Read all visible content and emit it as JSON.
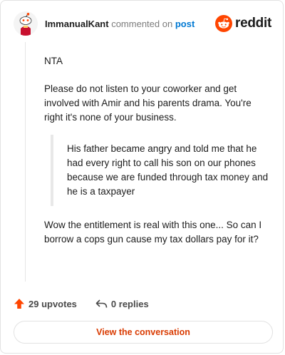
{
  "header": {
    "username": "ImmanualKant",
    "action_text": "commented on",
    "post_link": "post",
    "brand": "reddit",
    "avatar_icon": "reddit-snoo-avatar-icon",
    "logo_icon": "reddit-alien-logo-icon"
  },
  "comment": {
    "line1": "NTA",
    "line2": "Please do not listen to your coworker and get involved with Amir and his parents drama. You're right it's none of your business.",
    "quote": "His father became angry and told me that he had every right to call his son on our phones because we are funded through tax money and he is a taxpayer",
    "line3": "Wow the entitlement is real with this one... So can I borrow a cops gun cause my tax dollars pay for it?"
  },
  "footer": {
    "upvotes": "29 upvotes",
    "replies": "0 replies",
    "upvote_icon": "upvote-arrow-icon",
    "reply_icon": "reply-arrow-icon"
  },
  "cta": {
    "label": "View the conversation"
  },
  "colors": {
    "brand_orange": "#ff4500",
    "link_blue": "#0079d3",
    "cta_orange": "#d93a00"
  }
}
